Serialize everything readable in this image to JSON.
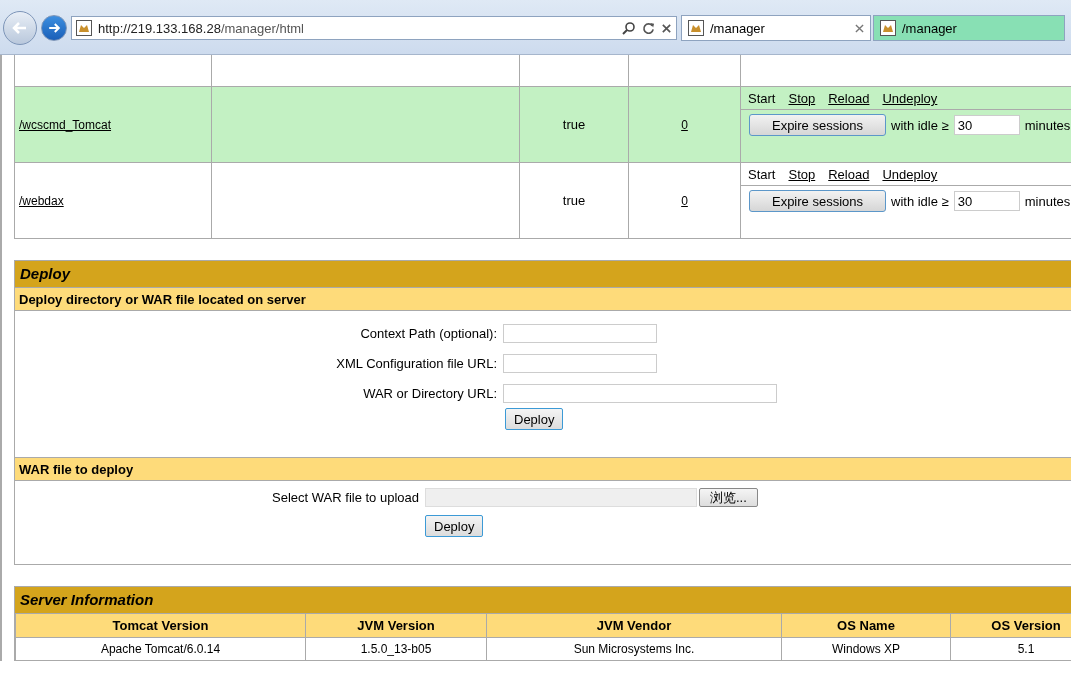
{
  "browser": {
    "address_host": "http://219.133.168.28",
    "address_path": "/manager/html",
    "tabs": [
      {
        "title": "/manager",
        "selected": true
      },
      {
        "title": "/manager",
        "selected": false
      }
    ]
  },
  "applications": [
    {
      "path": "/wcscmd_Tomcat",
      "running": "true",
      "sessions": "0",
      "highlighted": true,
      "commands": [
        "Start",
        "Stop",
        "Reload",
        "Undeploy"
      ],
      "expire_button": "Expire sessions",
      "idle_label": "with idle ≥",
      "idle_value": "30",
      "minutes": "minutes"
    },
    {
      "path": "/webdax",
      "running": "true",
      "sessions": "0",
      "highlighted": false,
      "commands": [
        "Start",
        "Stop",
        "Reload",
        "Undeploy"
      ],
      "expire_button": "Expire sessions",
      "idle_label": "with idle ≥",
      "idle_value": "30",
      "minutes": "minutes"
    }
  ],
  "deploy": {
    "title": "Deploy",
    "server_section": {
      "title": "Deploy directory or WAR file located on server",
      "fields": [
        {
          "label": "Context Path (optional):",
          "wide": false
        },
        {
          "label": "XML Configuration file URL:",
          "wide": false
        },
        {
          "label": "WAR or Directory URL:",
          "wide": true
        }
      ],
      "button": "Deploy"
    },
    "upload_section": {
      "title": "WAR file to deploy",
      "label": "Select WAR file to upload",
      "browse_button": "浏览...",
      "button": "Deploy"
    }
  },
  "server_info": {
    "title": "Server Information",
    "columns": [
      "Tomcat Version",
      "JVM Version",
      "JVM Vendor",
      "OS Name",
      "OS Version"
    ],
    "row": [
      "Apache Tomcat/6.0.14",
      "1.5.0_13-b05",
      "Sun Microsystems Inc.",
      "Windows XP",
      "5.1"
    ]
  }
}
